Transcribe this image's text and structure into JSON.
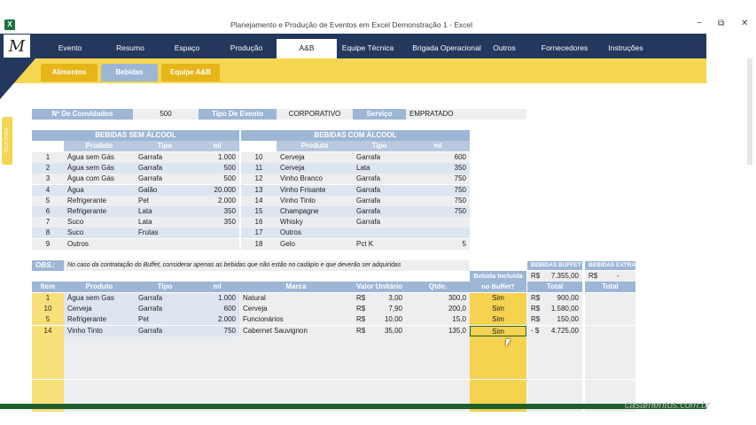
{
  "window": {
    "title": "Planejamento e Produção de Eventos em Excel Demonstração 1 - Excel",
    "app_icon": "excel-icon",
    "controls": [
      "−",
      "⧉",
      "✕"
    ]
  },
  "nav": {
    "items": [
      "Evento",
      "Resumo",
      "Espaço",
      "Produção",
      "A&B",
      "Equipe Técnica",
      "Brigada Operacional",
      "Outros",
      "Fornecedores",
      "Instruções"
    ],
    "active": "A&B"
  },
  "subtabs": [
    "Alimentos",
    "Bebidas",
    "Equipe A&B"
  ],
  "side_tab": "TELA CHEIA",
  "info": {
    "convidados_label": "Nº De Convidados",
    "convidados": "500",
    "tipo_label": "Tipo De Evento",
    "tipo": "CORPORATIVO",
    "servico_label": "Serviço",
    "servico": "EMPRATADO"
  },
  "sem_alcool": {
    "title": "BEBIDAS SEM ÁLCOOL",
    "headers": [
      "Produto",
      "Tipo",
      "ml"
    ],
    "rows": [
      [
        "1",
        "Água sem Gás",
        "Garrafa",
        "1.000"
      ],
      [
        "2",
        "Água sem Gás",
        "Garrafa",
        "500"
      ],
      [
        "3",
        "Água com Gás",
        "Garrafa",
        "500"
      ],
      [
        "4",
        "Água",
        "Galão",
        "20.000"
      ],
      [
        "5",
        "Refrigerante",
        "Pet",
        "2.000"
      ],
      [
        "6",
        "Refrigerante",
        "Lata",
        "350"
      ],
      [
        "7",
        "Suco",
        "Lata",
        "350"
      ],
      [
        "8",
        "Suco",
        "Frutas",
        ""
      ],
      [
        "9",
        "Outros",
        "",
        ""
      ]
    ]
  },
  "com_alcool": {
    "title": "BEBIDAS COM ÁLCOOL",
    "headers": [
      "Produto",
      "Tipo",
      "ml"
    ],
    "rows": [
      [
        "10",
        "Cerveja",
        "Garrafa",
        "600"
      ],
      [
        "11",
        "Cerveja",
        "Lata",
        "350"
      ],
      [
        "12",
        "Vinho Branco",
        "Garrafa",
        "750"
      ],
      [
        "13",
        "Vinho Frisante",
        "Garrafa",
        "750"
      ],
      [
        "14",
        "Vinho Tinto",
        "Garrafa",
        "750"
      ],
      [
        "15",
        "Champagne",
        "Garrafa",
        "750"
      ],
      [
        "16",
        "Whisky",
        "Garrafa",
        ""
      ],
      [
        "17",
        "Outros",
        "",
        ""
      ],
      [
        "18",
        "Gelo",
        "Pct K",
        "5"
      ]
    ]
  },
  "obs": {
    "label": "OBS.:",
    "text": "No caso da contratação do Buffet,  considerar apenas as bebidas que não estão no cadápio e que deverão ser adquiridas"
  },
  "order": {
    "headers": [
      "Item",
      "Produto",
      "Tipo",
      "ml",
      "Marca",
      "Valor Unitário",
      "Qtde."
    ],
    "incl_header_1": "Bebida Incluída",
    "incl_header_2": "no Buffet?",
    "buffet_title": "BEBIDAS BUFFET",
    "extra_title": "BEBIDAS EXTRA",
    "buffet_total_currency": "R$",
    "buffet_total": "7.355,00",
    "extra_total_currency": "R$",
    "extra_total": "-",
    "total_label": "Total",
    "rows": [
      {
        "item": "1",
        "produto": "Água sem Gas",
        "tipo": "Garrafa",
        "ml": "1.000",
        "marca": "Natural",
        "cur": "R$",
        "valor": "3,00",
        "qtde": "300,0",
        "incl": "Sim",
        "bcur": "R$",
        "btotal": "900,00"
      },
      {
        "item": "10",
        "produto": "Cerveja",
        "tipo": "Garrafa",
        "ml": "600",
        "marca": "Cerveja",
        "cur": "R$",
        "valor": "7,90",
        "qtde": "200,0",
        "incl": "Sim",
        "bcur": "R$",
        "btotal": "1.580,00"
      },
      {
        "item": "5",
        "produto": "Refrigerante",
        "tipo": "Pet",
        "ml": "2.000",
        "marca": "Funcionários",
        "cur": "R$",
        "valor": "10,00",
        "qtde": "15,0",
        "incl": "Sim",
        "bcur": "R$",
        "btotal": "150,00"
      },
      {
        "item": "14",
        "produto": "Vinho Tinto",
        "tipo": "Garrafa",
        "ml": "750",
        "marca": "Cabernet Sauvignon",
        "cur": "R$",
        "valor": "35,00",
        "qtde": "135,0",
        "incl": "Sim",
        "bcur": "- $",
        "btotal": "4.725,00"
      }
    ]
  },
  "watermark": "casamentos.com.br"
}
